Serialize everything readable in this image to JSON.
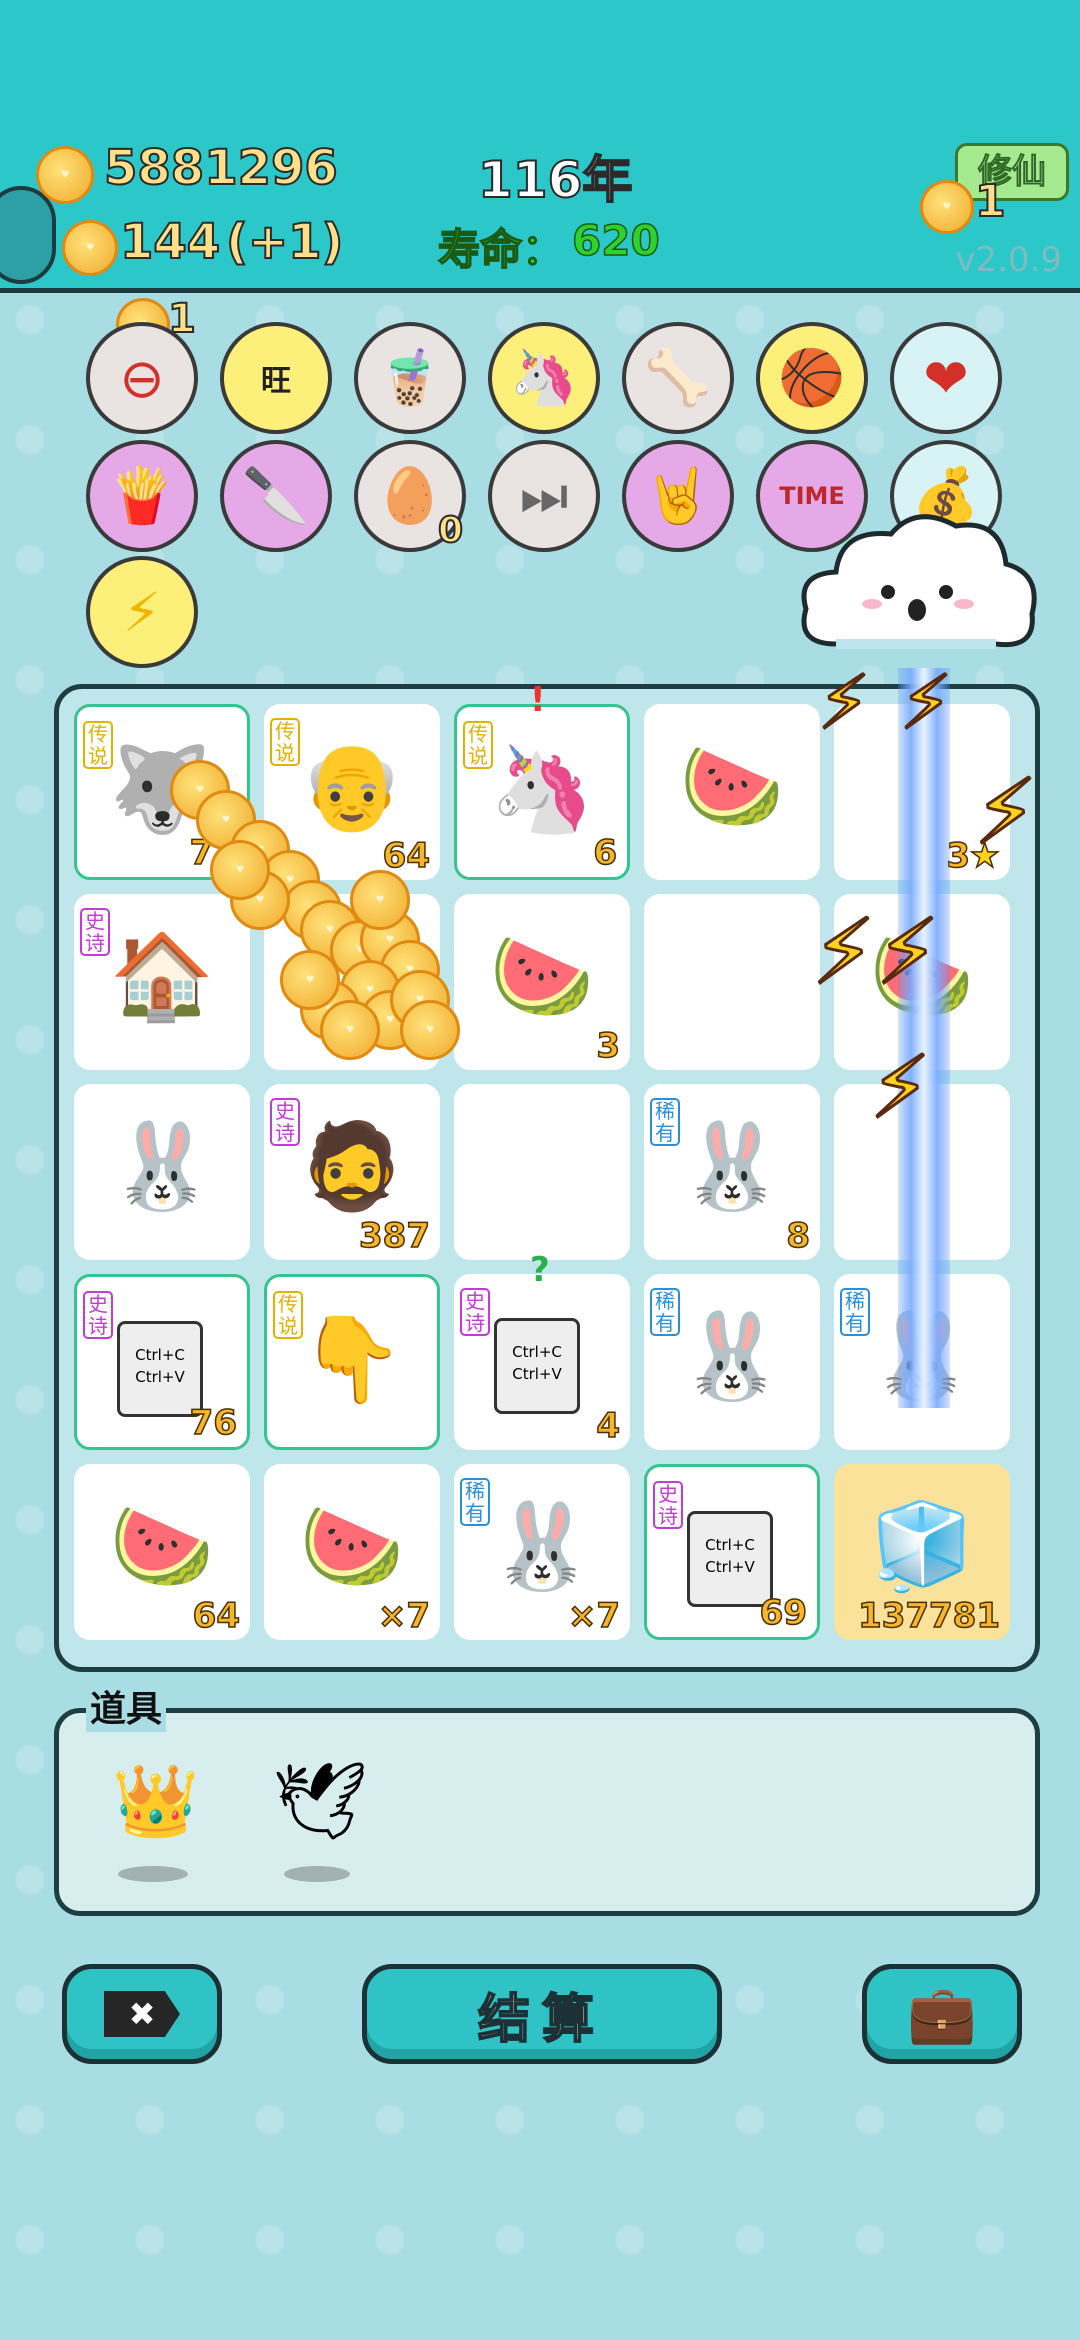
{
  "header": {
    "gold_amount": "5881296",
    "secondary_amount": "144",
    "secondary_increment": "(+1)",
    "year_label": "116年",
    "lifespan_label": "寿命：",
    "lifespan_value": "620",
    "mode_button": "修仙",
    "coin_count_right": "1",
    "version": "v2.0.9"
  },
  "item_tray": {
    "top_coin_count": "1",
    "row1": [
      {
        "icon": "no-entry-icon",
        "glyph": "⊖"
      },
      {
        "icon": "wang-candy-icon",
        "glyph": "旺"
      },
      {
        "icon": "bubble-tea-icon",
        "glyph": "🧋"
      },
      {
        "icon": "unicorn-icon",
        "glyph": "🦄"
      },
      {
        "icon": "dog-bowl-icon",
        "glyph": "🦴"
      },
      {
        "icon": "basketballs-icon",
        "glyph": "🏀"
      },
      {
        "icon": "blood-bag-icon",
        "glyph": "❤"
      }
    ],
    "row2": [
      {
        "icon": "fries-icon",
        "glyph": "🍟"
      },
      {
        "icon": "cleaver-icon",
        "glyph": "🔪"
      },
      {
        "icon": "egg-tray-icon",
        "glyph": "🥚",
        "count": "0"
      },
      {
        "icon": "skip-icon",
        "glyph": "⏭"
      },
      {
        "icon": "rock-hand-icon",
        "glyph": "🤘"
      },
      {
        "icon": "time-magazine-icon",
        "glyph": "TIME"
      },
      {
        "icon": "sack-icon",
        "glyph": "💰"
      }
    ],
    "row3": [
      {
        "icon": "lightning-icon",
        "glyph": "⚡"
      }
    ]
  },
  "board": {
    "cells": [
      {
        "icon": "crowned-husky-icon",
        "glyph": "🐺",
        "tag": "传说",
        "count": "72",
        "border": "green"
      },
      {
        "icon": "old-man-face-icon",
        "glyph": "👴",
        "tag": "传说",
        "count": "64"
      },
      {
        "icon": "unicorn-icon",
        "glyph": "🦄",
        "tag": "传说",
        "count": "6",
        "border": "green",
        "mark": "!"
      },
      {
        "icon": "watermelon-icon",
        "glyph": "🍉",
        "count": ""
      },
      {
        "icon": "empty",
        "glyph": "",
        "count": "3",
        "star": "★"
      },
      {
        "icon": "rabbit-house-icon",
        "glyph": "🏠",
        "tag": "史诗",
        "count": ""
      },
      {
        "icon": "empty",
        "glyph": "",
        "count": ""
      },
      {
        "icon": "watermelon-icon",
        "glyph": "🍉",
        "count": "3"
      },
      {
        "icon": "empty",
        "glyph": "",
        "count": ""
      },
      {
        "icon": "watermelon-icon",
        "glyph": "🍉",
        "count": ""
      },
      {
        "icon": "rabbit-icon",
        "glyph": "🐰",
        "count": ""
      },
      {
        "icon": "bearded-man-icon",
        "glyph": "🧔",
        "tag": "史诗",
        "count": "387"
      },
      {
        "icon": "empty",
        "glyph": "",
        "count": ""
      },
      {
        "icon": "rabbit-icon",
        "glyph": "🐰",
        "tag": "稀有",
        "count": "8"
      },
      {
        "icon": "empty",
        "glyph": "",
        "count": ""
      },
      {
        "icon": "copy-paste-icon",
        "glyph": "ctrl",
        "tag": "史诗",
        "count": "76",
        "border": "green"
      },
      {
        "icon": "pointing-hand-icon",
        "glyph": "👇",
        "tag": "传说",
        "count": "",
        "border": "green"
      },
      {
        "icon": "copy-paste-icon",
        "glyph": "ctrl",
        "tag": "史诗",
        "count": "4",
        "mark": "?"
      },
      {
        "icon": "rabbit-icon",
        "glyph": "🐰",
        "tag": "稀有",
        "count": ""
      },
      {
        "icon": "rabbit-icon",
        "glyph": "🐰",
        "tag": "稀有",
        "count": ""
      },
      {
        "icon": "watermelon-icon",
        "glyph": "🍉",
        "count": "64"
      },
      {
        "icon": "watermelon-icon",
        "glyph": "🍉",
        "count": "×7"
      },
      {
        "icon": "rabbit-icon",
        "glyph": "🐰",
        "tag": "稀有",
        "count": "×7"
      },
      {
        "icon": "copy-paste-icon",
        "glyph": "ctrl",
        "tag": "史诗",
        "count": "69",
        "border": "green"
      },
      {
        "icon": "refrigerator-icon",
        "glyph": "🧊",
        "count": "137781",
        "bg": "gold"
      }
    ],
    "copy_text_line1": "Ctrl+C",
    "copy_text_line2": "Ctrl+V"
  },
  "props": {
    "label": "道具",
    "items": [
      {
        "icon": "crown-icon",
        "glyph": "👑"
      },
      {
        "icon": "white-bird-icon",
        "glyph": "🕊"
      }
    ]
  },
  "buttons": {
    "close": "✖",
    "settle": "结算",
    "bag": "💼"
  },
  "colors": {
    "header_bg": "#2cc7c9",
    "page_bg": "#a9dde4",
    "count_gold": "#f5b62a",
    "legend_tag": "#e2b100",
    "epic_tag": "#c33ad6",
    "rare_tag": "#2a8fd8"
  }
}
